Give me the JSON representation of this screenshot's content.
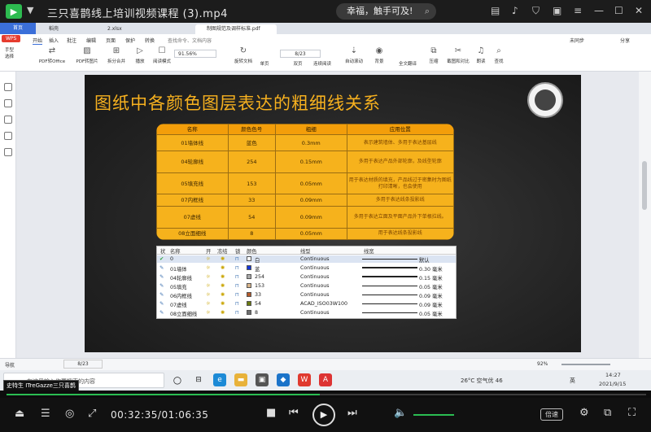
{
  "player": {
    "title": "三只喜鹊线上培训视频课程 (3).mp4",
    "promo": "幸福，触手可及!",
    "promo_more": "搜索"
  },
  "wps": {
    "tabs": [
      "首页",
      "稻壳",
      "2.xlsx",
      "制图规范及调样标准.pdf"
    ],
    "menu": [
      "开始",
      "插入",
      "批注",
      "编辑",
      "页面",
      "保护",
      "转换",
      "查找命令、文档内容"
    ],
    "menu_right": [
      "未同步",
      "分享"
    ],
    "wps_btn": "WPS",
    "ribbon": [
      "手型",
      "选择",
      "PDF转Office",
      "PDF转图片",
      "拆分合并",
      "播放",
      "阅读模式",
      "旋转文档",
      "单页",
      "双页",
      "连续阅读",
      "自动滚动",
      "背景",
      "全文翻译",
      "压缩",
      "截图和对比",
      "朗读",
      "查找"
    ],
    "zoom": "91.56%",
    "page": "8/23",
    "status_page": "8/23",
    "status_nav": "导航",
    "status_zoom": "92%"
  },
  "slide": {
    "title": "图纸中各颜色图层表达的粗细线关系",
    "table": {
      "headers": [
        "名称",
        "颜色色号",
        "粗细",
        "应用位置"
      ],
      "rows": [
        [
          "01墙体线",
          "蓝色",
          "0.3mm",
          "表示建筑墙体、多用于表达基层线"
        ],
        [
          "04轮廓线",
          "254",
          "0.15mm",
          "多用于表达产品外部轮廓，及线型轮廓"
        ],
        [
          "05填充线",
          "153",
          "0.05mm",
          "用于表达材质的填充，产品线过于密集时为图纸打印清晰，也会使用"
        ],
        [
          "07内框线",
          "33",
          "0.09mm",
          "多用于表达线条投影线"
        ],
        [
          "07虚线",
          "54",
          "0.09mm",
          "多用于表达立面及平面产品外下单根拉线。"
        ],
        [
          "08立面细线",
          "8",
          "0.05mm",
          "用于表达线条投影线"
        ]
      ]
    },
    "layers": {
      "headers": [
        "状",
        "名称",
        "开",
        "冻结",
        "锁",
        "颜色",
        "线型",
        "线宽"
      ],
      "rows": [
        {
          "name": "0",
          "color": "白",
          "linetype": "Continuous",
          "lw": "默认",
          "sw": "#ffffff"
        },
        {
          "name": "01墙体",
          "color": "蓝",
          "linetype": "Continuous",
          "lw": "0.30 毫米",
          "sw": "#1436d8"
        },
        {
          "name": "04轮廓线",
          "color": "254",
          "linetype": "Continuous",
          "lw": "0.15 毫米",
          "sw": "#aaaaaa"
        },
        {
          "name": "05填充",
          "color": "153",
          "linetype": "Continuous",
          "lw": "0.05 毫米",
          "sw": "#d6b38a"
        },
        {
          "name": "06内框线",
          "color": "33",
          "linetype": "Continuous",
          "lw": "0.09 毫米",
          "sw": "#b35a2a"
        },
        {
          "name": "07虚线",
          "color": "54",
          "linetype": "ACAD_ISO03W100",
          "lw": "0.09 毫米",
          "sw": "#6a7a10"
        },
        {
          "name": "08立面细线",
          "color": "8",
          "linetype": "Continuous",
          "lw": "0.05 毫米",
          "sw": "#6e6e6e"
        }
      ]
    }
  },
  "taskbar": {
    "search_placeholder": "在这里输入你要搜索的内容",
    "overlay": "史特生 ITreGazze三只喜鹊",
    "weather": "26°C 空气优 46",
    "lang": "英",
    "time": "14:27",
    "date": "2021/9/15"
  },
  "controls": {
    "time": "00:32:35/01:06:35",
    "speed": "倍速",
    "progress": 0.49
  }
}
